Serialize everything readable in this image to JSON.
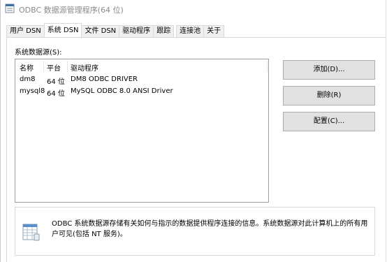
{
  "window": {
    "title": "ODBC 数据源管理程序(64 位)"
  },
  "tabs": [
    {
      "label": "用户 DSN",
      "active": false
    },
    {
      "label": "系统 DSN",
      "active": true
    },
    {
      "label": "文件 DSN",
      "active": false
    },
    {
      "label": "驱动程序",
      "active": false
    },
    {
      "label": "跟踪",
      "active": false
    },
    {
      "label": "连接池",
      "active": false
    },
    {
      "label": "关于",
      "active": false
    }
  ],
  "system_dsn": {
    "section_label": "系统数据源(S):",
    "columns": [
      "名称",
      "平台",
      "驱动程序"
    ],
    "rows": [
      {
        "name": "dm8",
        "platform": "64 位",
        "driver": "DM8 ODBC DRIVER"
      },
      {
        "name": "mysql8",
        "platform": "64 位",
        "driver": "MySQL ODBC 8.0 ANSI Driver"
      }
    ],
    "buttons": {
      "add": "添加(D)...",
      "remove": "删除(R)",
      "configure": "配置(C)..."
    },
    "info_text": "ODBC 系统数据源存储有关如何与指示的数据提供程序连接的信息。系统数据源对此计算机上的所有用户可见(包括 NT 服务)。"
  },
  "colors": {
    "button_face": "#e1e1e1",
    "button_border": "#adadad",
    "title_text": "#8a8a8a",
    "tab_face": "#f0f0f0",
    "list_border": "#9d9d9d"
  },
  "icons": {
    "title": "odbc-window-icon",
    "info": "database-table-icon"
  }
}
